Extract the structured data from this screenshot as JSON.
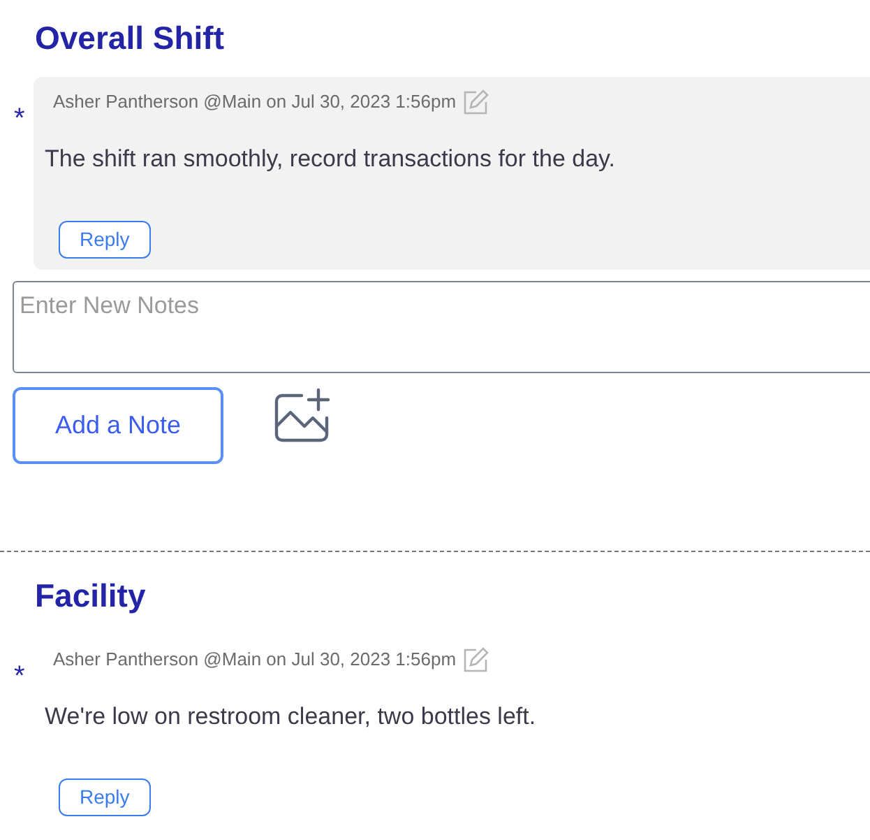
{
  "sections": [
    {
      "title": "Overall Shift",
      "notes": [
        {
          "marker": "*",
          "meta": "Asher Pantherson @Main on Jul 30, 2023 1:56pm",
          "body": "The shift ran smoothly, record transactions for the day.",
          "reply": "Reply",
          "highlighted": true
        }
      ],
      "composer": {
        "placeholder": "Enter New Notes",
        "button": "Add a Note"
      }
    },
    {
      "title": "Facility",
      "notes": [
        {
          "marker": "*",
          "meta": "Asher Pantherson @Main on Jul 30, 2023 1:56pm",
          "body": "We're low on restroom cleaner, two bottles left.",
          "reply": "Reply",
          "highlighted": false
        }
      ]
    }
  ]
}
